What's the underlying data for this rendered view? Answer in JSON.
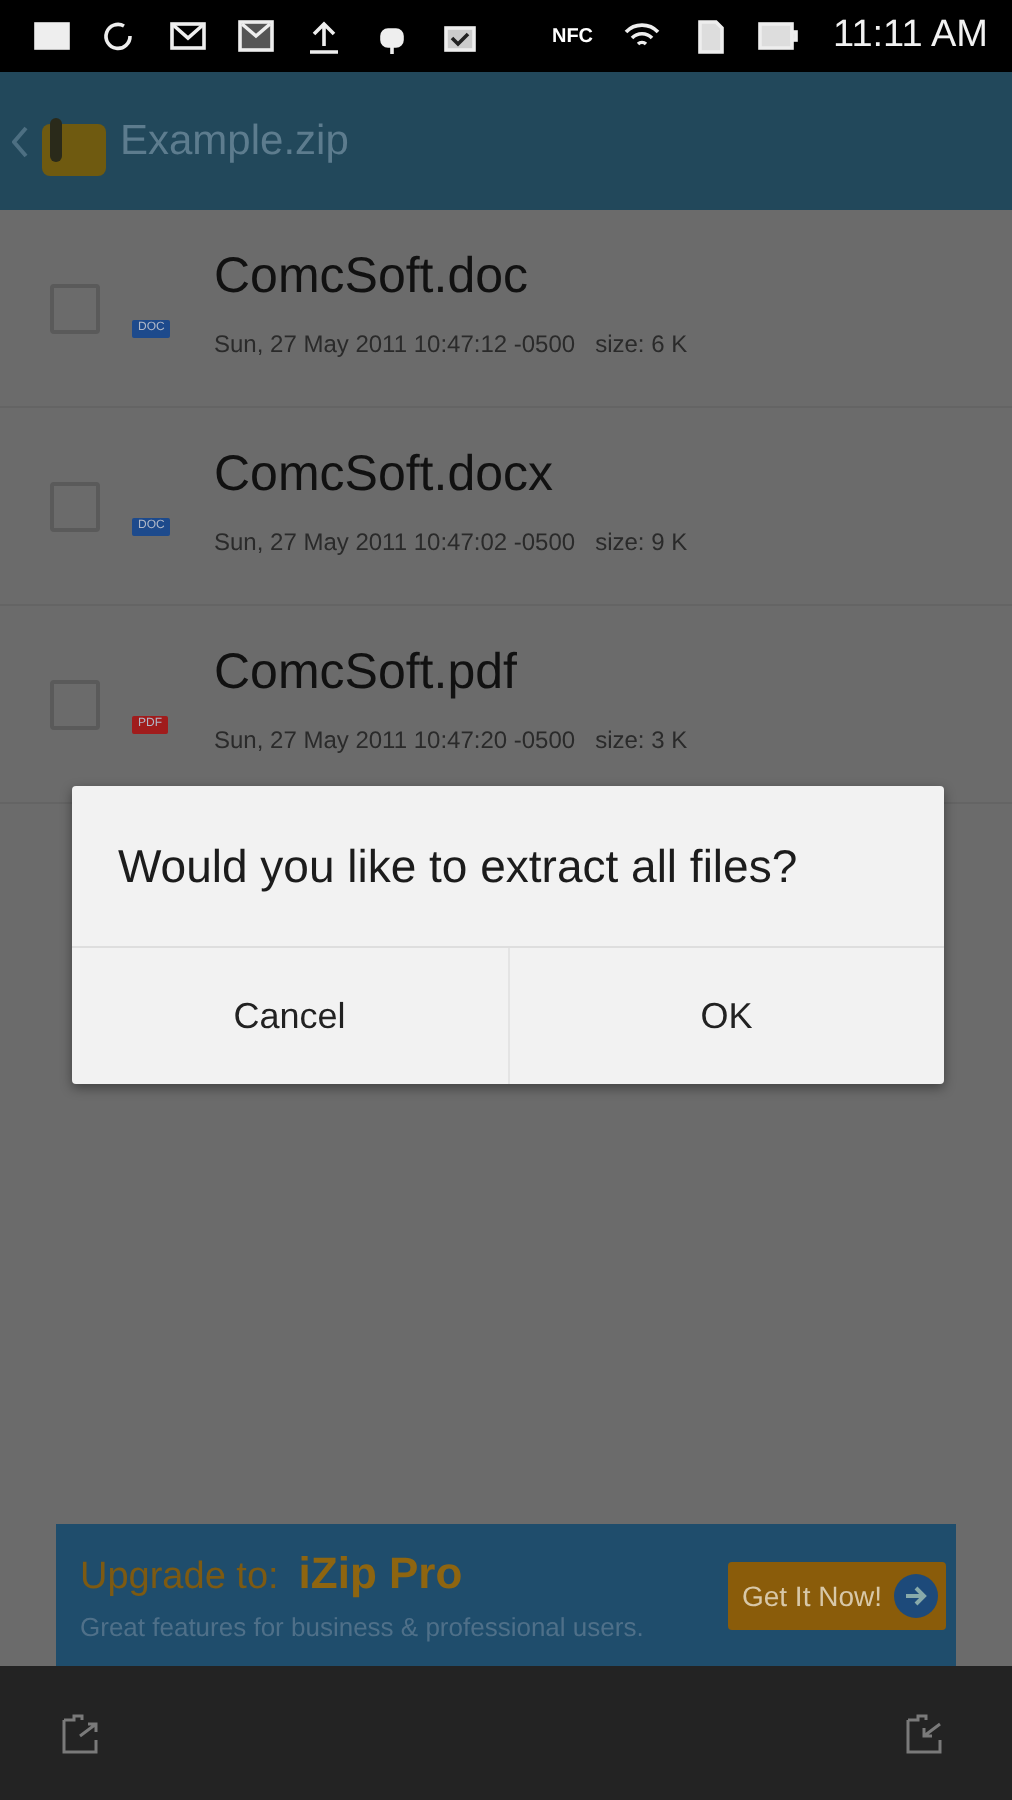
{
  "status_bar": {
    "nfc_label": "NFC",
    "time": "11:11 AM"
  },
  "app_bar": {
    "title": "Example.zip"
  },
  "files": [
    {
      "name": "ComcSoft.doc",
      "badge": "DOC",
      "color": "#1d4a8c",
      "date": "Sun, 27 May 2011 10:47:12 -0500",
      "size": "size: 6 K",
      "checked": false
    },
    {
      "name": "ComcSoft.docx",
      "badge": "DOC",
      "color": "#1d4a8c",
      "date": "Sun, 27 May 2011 10:47:02 -0500",
      "size": "size: 9 K",
      "checked": false
    },
    {
      "name": "ComcSoft.pdf",
      "badge": "PDF",
      "color": "#a01c1c",
      "date": "Sun, 27 May 2011 10:47:20 -0500",
      "size": "size: 3 K",
      "checked": false
    }
  ],
  "dialog": {
    "message": "Would you like to extract all files?",
    "buttons": [
      "Cancel",
      "OK"
    ]
  },
  "ad": {
    "title_lead": "Upgrade to:",
    "title_product": "iZip Pro",
    "subtitle": "Great features for business & professional users.",
    "button": "Get It Now!"
  }
}
